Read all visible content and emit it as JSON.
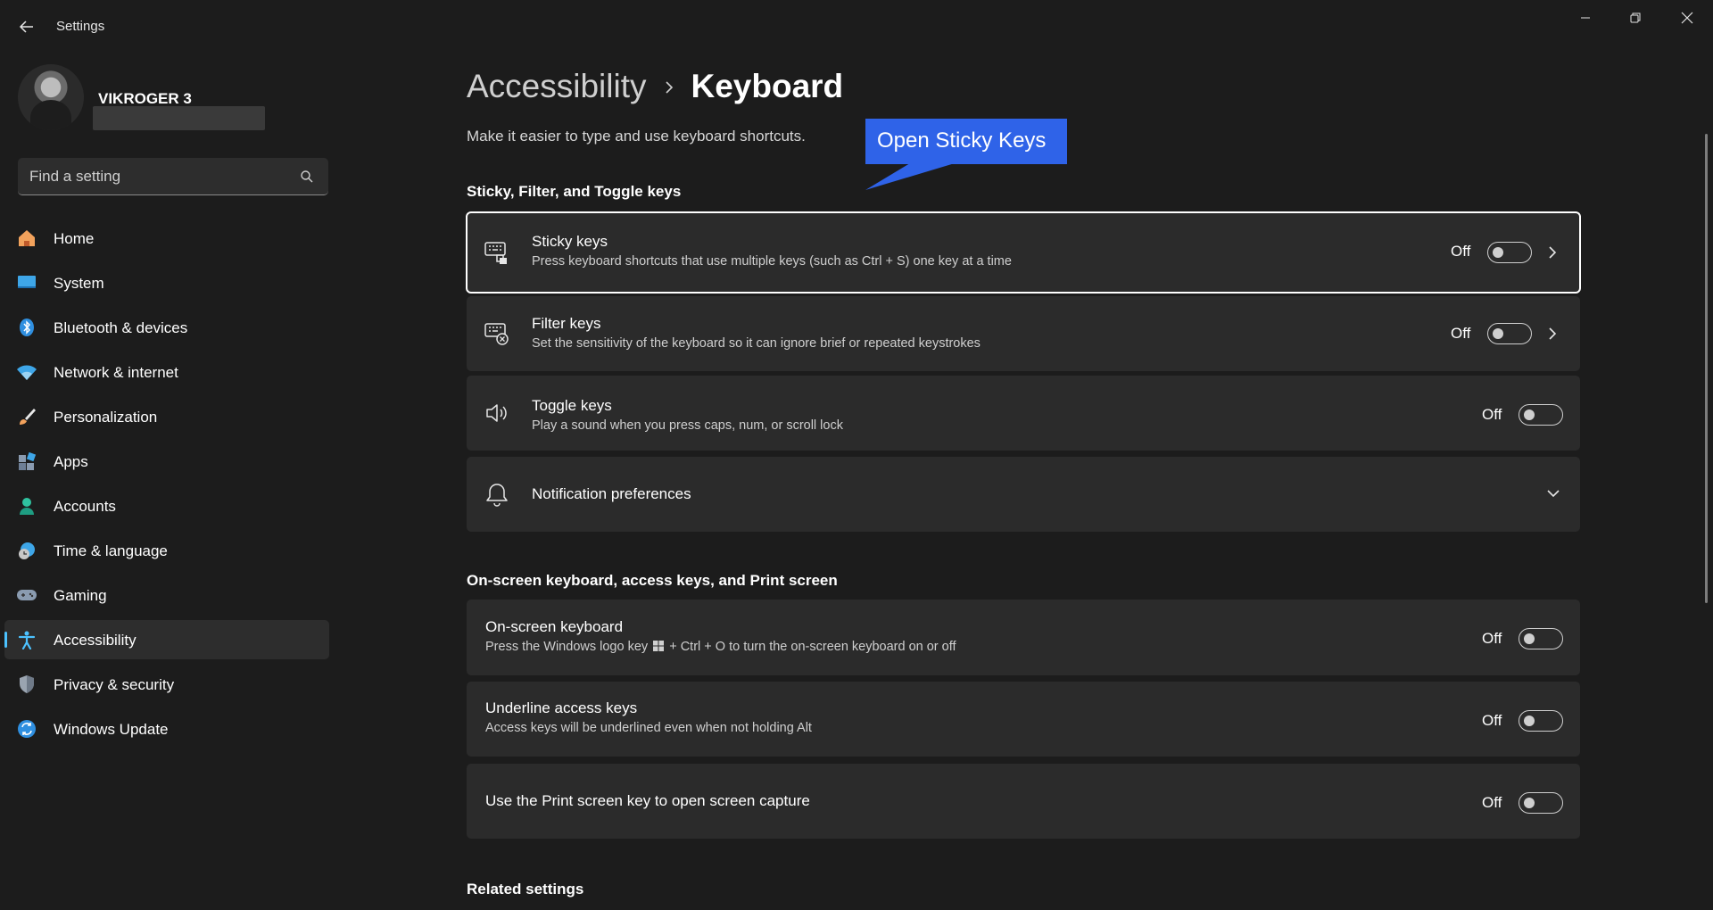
{
  "app": {
    "title": "Settings"
  },
  "profile": {
    "name": "VIKROGER 3"
  },
  "search": {
    "placeholder": "Find a setting"
  },
  "nav": {
    "items": [
      {
        "label": "Home",
        "icon": "home-icon"
      },
      {
        "label": "System",
        "icon": "system-icon"
      },
      {
        "label": "Bluetooth & devices",
        "icon": "bluetooth-icon"
      },
      {
        "label": "Network & internet",
        "icon": "wifi-icon"
      },
      {
        "label": "Personalization",
        "icon": "brush-icon"
      },
      {
        "label": "Apps",
        "icon": "apps-icon"
      },
      {
        "label": "Accounts",
        "icon": "accounts-icon"
      },
      {
        "label": "Time & language",
        "icon": "time-language-icon"
      },
      {
        "label": "Gaming",
        "icon": "gamepad-icon"
      },
      {
        "label": "Accessibility",
        "icon": "accessibility-icon",
        "active": true
      },
      {
        "label": "Privacy & security",
        "icon": "shield-icon"
      },
      {
        "label": "Windows Update",
        "icon": "update-icon"
      }
    ]
  },
  "main": {
    "breadcrumb_parent": "Accessibility",
    "breadcrumb_current": "Keyboard",
    "description": "Make it easier to type and use keyboard shortcuts.",
    "section1": {
      "title": "Sticky, Filter, and Toggle keys",
      "items": [
        {
          "title": "Sticky keys",
          "subtitle": "Press keyboard shortcuts that use multiple keys (such as Ctrl + S) one key at a time",
          "state": "Off"
        },
        {
          "title": "Filter keys",
          "subtitle": "Set the sensitivity of the keyboard so it can ignore brief or repeated keystrokes",
          "state": "Off"
        },
        {
          "title": "Toggle keys",
          "subtitle": "Play a sound when you press caps, num, or scroll lock",
          "state": "Off"
        },
        {
          "title": "Notification preferences"
        }
      ]
    },
    "section2": {
      "title": "On-screen keyboard, access keys, and Print screen",
      "items": [
        {
          "title": "On-screen keyboard",
          "subtitle_pre": "Press the Windows logo key",
          "subtitle_post": "+ Ctrl + O to turn the on-screen keyboard on or off",
          "state": "Off"
        },
        {
          "title": "Underline access keys",
          "subtitle": "Access keys will be underlined even when not holding Alt",
          "state": "Off"
        },
        {
          "title": "Use the Print screen key to open screen capture",
          "state": "Off"
        }
      ]
    },
    "section3": {
      "title": "Related settings"
    }
  },
  "callout": {
    "text": "Open Sticky Keys"
  },
  "colors": {
    "accent": "#4cc2ff",
    "callout": "#2f63e8",
    "card": "#2b2b2b",
    "background": "#1c1c1c"
  }
}
